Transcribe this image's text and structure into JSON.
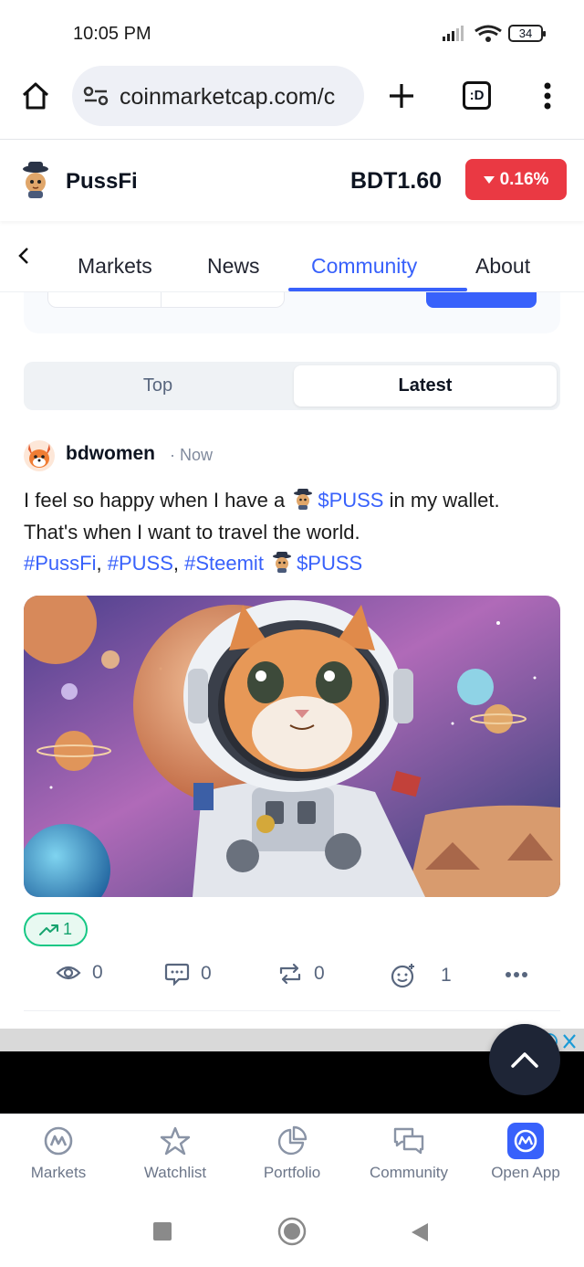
{
  "status_bar": {
    "time": "10:05 PM",
    "battery": "34"
  },
  "browser": {
    "url": "coinmarketcap.com/c",
    "tab_switcher_label": ":D"
  },
  "coin": {
    "name": "PussFi",
    "price": "BDT1.60",
    "change": "0.16%",
    "change_color": "#ea3943"
  },
  "tabs": [
    {
      "label": "Markets"
    },
    {
      "label": "News"
    },
    {
      "label": "Community",
      "active": true
    },
    {
      "label": "About"
    }
  ],
  "feed_toggle": {
    "top_label": "Top",
    "latest_label": "Latest",
    "selected": "Latest"
  },
  "post": {
    "author": "bdwomen",
    "time": "· Now",
    "text_line1_a": "I feel so happy when I have a",
    "cashtag1": "$PUSS",
    "text_line1_b": "in my wallet.",
    "text_line2": "That's when I want to travel the world.",
    "hashtag1": "#PussFi",
    "hashtag2": "#PUSS",
    "hashtag3": "#Steemit",
    "cashtag2": "$PUSS",
    "bullish_count": "1",
    "views": "0",
    "comments": "0",
    "reposts": "0",
    "reactions": "1"
  },
  "bottom_nav": [
    {
      "label": "Markets",
      "icon": "markets-icon"
    },
    {
      "label": "Watchlist",
      "icon": "star-icon"
    },
    {
      "label": "Portfolio",
      "icon": "pie-chart-icon"
    },
    {
      "label": "Community",
      "icon": "chat-icon"
    },
    {
      "label": "Open App",
      "icon": "cmc-app-icon"
    }
  ],
  "colors": {
    "accent": "#3861fb",
    "negative": "#ea3943",
    "positive": "#16c784"
  }
}
